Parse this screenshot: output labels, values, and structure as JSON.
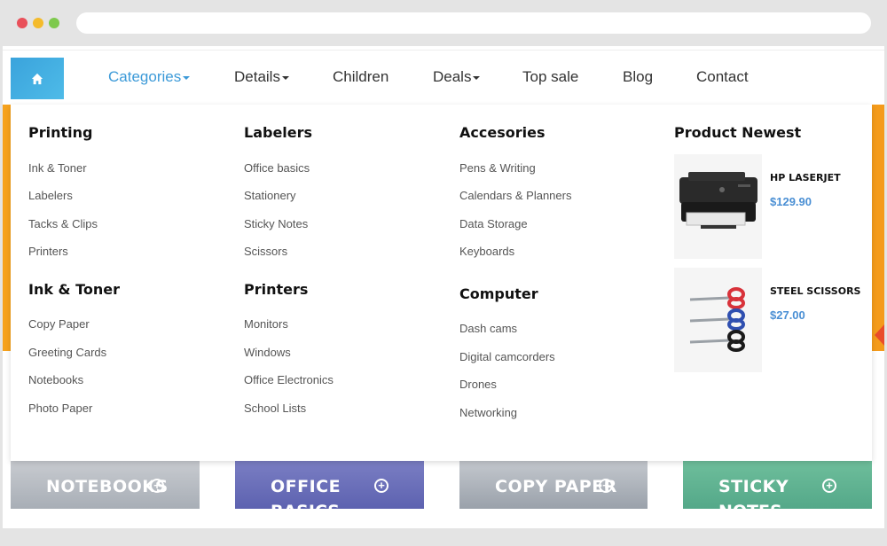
{
  "nav": {
    "items": [
      {
        "label": "Categories",
        "active": true,
        "dropdown": true
      },
      {
        "label": "Details",
        "dropdown": true
      },
      {
        "label": "Children"
      },
      {
        "label": "Deals",
        "dropdown": true
      },
      {
        "label": "Top sale"
      },
      {
        "label": "Blog"
      },
      {
        "label": "Contact"
      }
    ],
    "home_icon": "home-icon"
  },
  "menu": {
    "columns": [
      {
        "title": "Printing",
        "items": [
          "Ink & Toner",
          "Labelers",
          "Tacks & Clips",
          "Printers"
        ]
      },
      {
        "title": "Labelers",
        "items": [
          "Office basics",
          "Stationery",
          "Sticky Notes",
          "Scissors"
        ]
      },
      {
        "title": "Accesories",
        "items": [
          "Pens & Writing",
          "Calendars & Planners",
          "Data Storage",
          "Keyboards"
        ]
      },
      {
        "title": "Ink & Toner",
        "items": [
          "Copy Paper",
          "Greeting Cards",
          "Notebooks",
          "Photo Paper"
        ]
      },
      {
        "title": "Printers",
        "items": [
          "Monitors",
          "Windows",
          "Office Electronics",
          "School Lists"
        ]
      },
      {
        "title": "Computer",
        "items": [
          "Dash cams",
          "Digital camcorders",
          "Drones",
          "Networking"
        ]
      }
    ],
    "newest": {
      "title": "Product Newest",
      "products": [
        {
          "name": "HP LASERJET",
          "price": "$129.90",
          "icon": "printer-image"
        },
        {
          "name": "STEEL SCISSORS",
          "price": "$27.00",
          "icon": "scissors-image"
        }
      ]
    }
  },
  "cards": [
    {
      "label": "NOTEBOOKS",
      "label2": ""
    },
    {
      "label": "OFFICE",
      "label2": "BASICS"
    },
    {
      "label": "COPY PAPER",
      "label2": ""
    },
    {
      "label": "STICKY",
      "label2": "NOTES"
    }
  ],
  "colors": {
    "accent": "#3c9ad8",
    "price": "#4a8fd4",
    "home_button": "#3aa3dc"
  }
}
